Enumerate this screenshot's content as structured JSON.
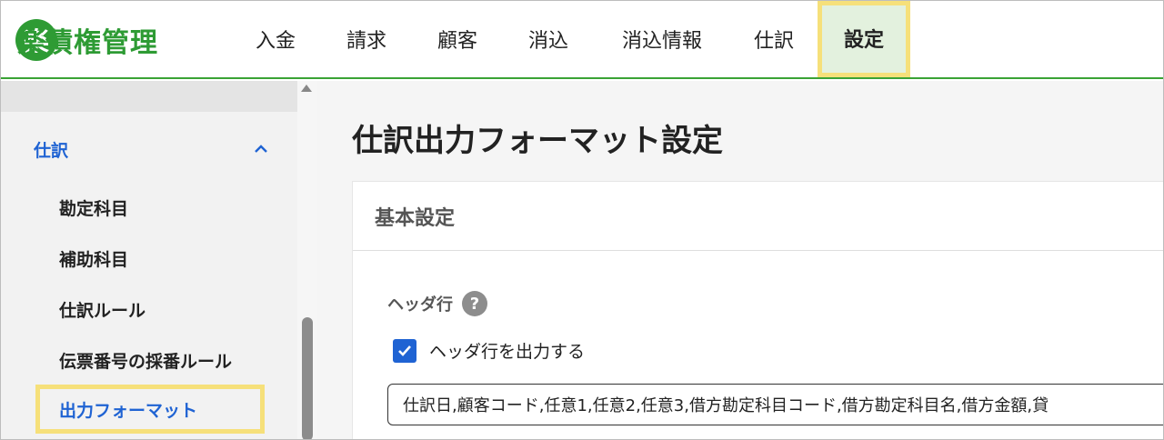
{
  "header": {
    "logo_mark": "楽",
    "logo_text": "楽債権管理",
    "nav": [
      {
        "label": "入金"
      },
      {
        "label": "請求"
      },
      {
        "label": "顧客"
      },
      {
        "label": "消込"
      },
      {
        "label": "消込情報"
      },
      {
        "label": "仕訳"
      },
      {
        "label": "設定"
      }
    ]
  },
  "sidebar": {
    "section_label": "仕訳",
    "items": [
      {
        "label": "勘定科目"
      },
      {
        "label": "補助科目"
      },
      {
        "label": "仕訳ルール"
      },
      {
        "label": "伝票番号の採番ルール"
      },
      {
        "label": "出力フォーマット"
      }
    ]
  },
  "main": {
    "page_title": "仕訳出力フォーマット設定",
    "card_title": "基本設定",
    "header_row_label": "ヘッダ行",
    "help_glyph": "?",
    "checkbox_label": "ヘッダ行を出力する",
    "checkbox_checked": true,
    "header_value": "仕訳日,顧客コード,任意1,任意2,任意3,借方勘定科目コード,借方勘定科目名,借方金額,貸"
  },
  "colors": {
    "brand_green": "#2e9b34",
    "link_blue": "#1f63d3",
    "highlight_yellow": "#f6e07a",
    "active_tab_bg": "#e3f1de"
  }
}
